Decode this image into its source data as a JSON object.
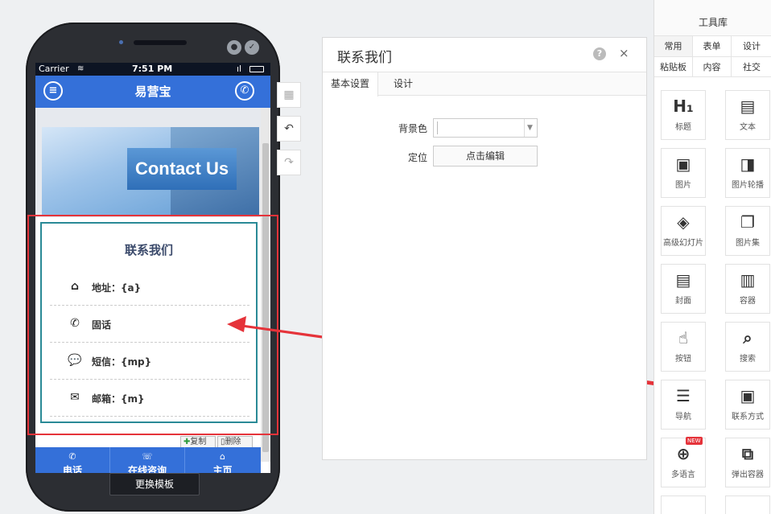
{
  "phone": {
    "carrier": "Carrier",
    "wifi_icon": "wifi-icon",
    "time": "7:51 PM",
    "signal": "ıl",
    "battery_icon": "battery-icon",
    "app_title": "易营宝",
    "banner_text": "Contact Us",
    "contact": {
      "title": "联系我们",
      "rows": [
        {
          "icon": "home-icon",
          "glyph": "⌂",
          "label": "地址：{a}"
        },
        {
          "icon": "phone-icon",
          "glyph": "✆",
          "label": "固话"
        },
        {
          "icon": "chat-icon",
          "glyph": "💬",
          "label": "短信：{mp}"
        },
        {
          "icon": "mail-icon",
          "glyph": "✉",
          "label": "邮箱：{m}"
        }
      ],
      "copy_label": "复制",
      "delete_label": "删除"
    },
    "tabs": [
      {
        "icon": "phone-icon",
        "glyph": "✆",
        "label": "电话"
      },
      {
        "icon": "chat-icon",
        "glyph": "☏",
        "label": "在线咨询"
      },
      {
        "icon": "home-icon",
        "glyph": "⌂",
        "label": "主页"
      }
    ],
    "template_button": "更换模板"
  },
  "side_tools": [
    {
      "icon": "qr-code-icon",
      "glyph": "▦"
    },
    {
      "icon": "undo-icon",
      "glyph": "↶"
    },
    {
      "icon": "redo-icon",
      "glyph": "↷"
    }
  ],
  "panel": {
    "title": "联系我们",
    "help": "?",
    "close": "×",
    "tabs": [
      "基本设置",
      "设计"
    ],
    "bg_label": "背景色",
    "bg_value": "",
    "position_label": "定位",
    "position_button": "点击编辑"
  },
  "toolbox": {
    "title": "工具库",
    "tabs_row1": [
      "常用",
      "表单",
      "设计"
    ],
    "tabs_row2": [
      "粘贴板",
      "内容",
      "社交"
    ],
    "tools": [
      {
        "icon": "heading-icon",
        "glyph": "H₁",
        "label": "标题"
      },
      {
        "icon": "text-file-icon",
        "glyph": "▤",
        "label": "文本"
      },
      {
        "icon": "image-icon",
        "glyph": "▣",
        "label": "图片"
      },
      {
        "icon": "image-carousel-icon",
        "glyph": "◨",
        "label": "图片轮播"
      },
      {
        "icon": "slideshow-icon",
        "glyph": "◈",
        "label": "高级幻灯片"
      },
      {
        "icon": "image-gallery-icon",
        "glyph": "❐",
        "label": "图片集"
      },
      {
        "icon": "cover-icon",
        "glyph": "▤",
        "label": "封面"
      },
      {
        "icon": "container-icon",
        "glyph": "▥",
        "label": "容器"
      },
      {
        "icon": "button-icon",
        "glyph": "☝",
        "label": "按钮"
      },
      {
        "icon": "search-icon",
        "glyph": "⌕",
        "label": "搜索"
      },
      {
        "icon": "nav-icon",
        "glyph": "☰",
        "label": "导航"
      },
      {
        "icon": "contact-card-icon",
        "glyph": "▣",
        "label": "联系方式"
      },
      {
        "icon": "globe-icon",
        "glyph": "⊕",
        "label": "多语言"
      },
      {
        "icon": "popup-container-icon",
        "glyph": "⧉",
        "label": "弹出容器"
      }
    ],
    "new_badge": "NEW"
  },
  "colors": {
    "primary": "#3470d9",
    "selection": "#e5333a",
    "border_teal": "#2a8a96"
  }
}
